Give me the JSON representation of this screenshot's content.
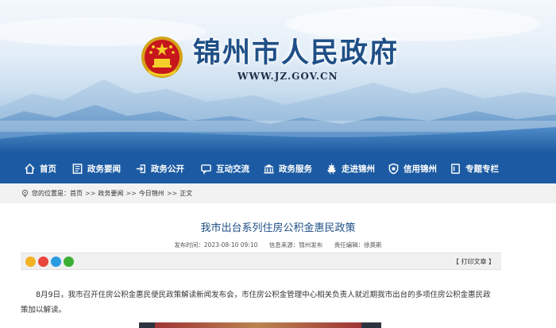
{
  "site": {
    "title": "锦州市人民政府",
    "url": "WWW.JZ.GOV.CN"
  },
  "nav": {
    "items": [
      {
        "label": "首页",
        "icon": "home-icon"
      },
      {
        "label": "政务要闻",
        "icon": "news-icon"
      },
      {
        "label": "政务公开",
        "icon": "login-icon"
      },
      {
        "label": "互动交流",
        "icon": "chat-icon"
      },
      {
        "label": "政务服务",
        "icon": "building-icon"
      },
      {
        "label": "走进锦州",
        "icon": "pagoda-icon"
      },
      {
        "label": "信用锦州",
        "icon": "shield-icon"
      },
      {
        "label": "专题专栏",
        "icon": "document-icon"
      }
    ]
  },
  "breadcrumb": {
    "prefix": "您的位置是：",
    "items": [
      "首页",
      "政务要闻",
      "今日锦州",
      "正文"
    ],
    "separator": ">>"
  },
  "article": {
    "title": "我市出台系列住房公积金惠民政策",
    "publish_time": "发布时间：2023-08-10 09:10",
    "source": "信息来源：锦州发布",
    "editor": "责任编辑：徐莫斯",
    "print_label": "【 打印文章 】",
    "share_icons": [
      "qzone-icon",
      "weibo-icon",
      "qq-icon",
      "wechat-icon"
    ],
    "paragraph": "8月9日，我市召开住房公积金惠民便民政策解读新闻发布会，市住房公积金管理中心相关负责人就近期我市出台的多项住房公积金惠民政策加以解读。"
  },
  "colors": {
    "nav_bg": "#1c5ba3",
    "title_color": "#1f4f86",
    "crumb_bg": "#f2f2f2"
  }
}
